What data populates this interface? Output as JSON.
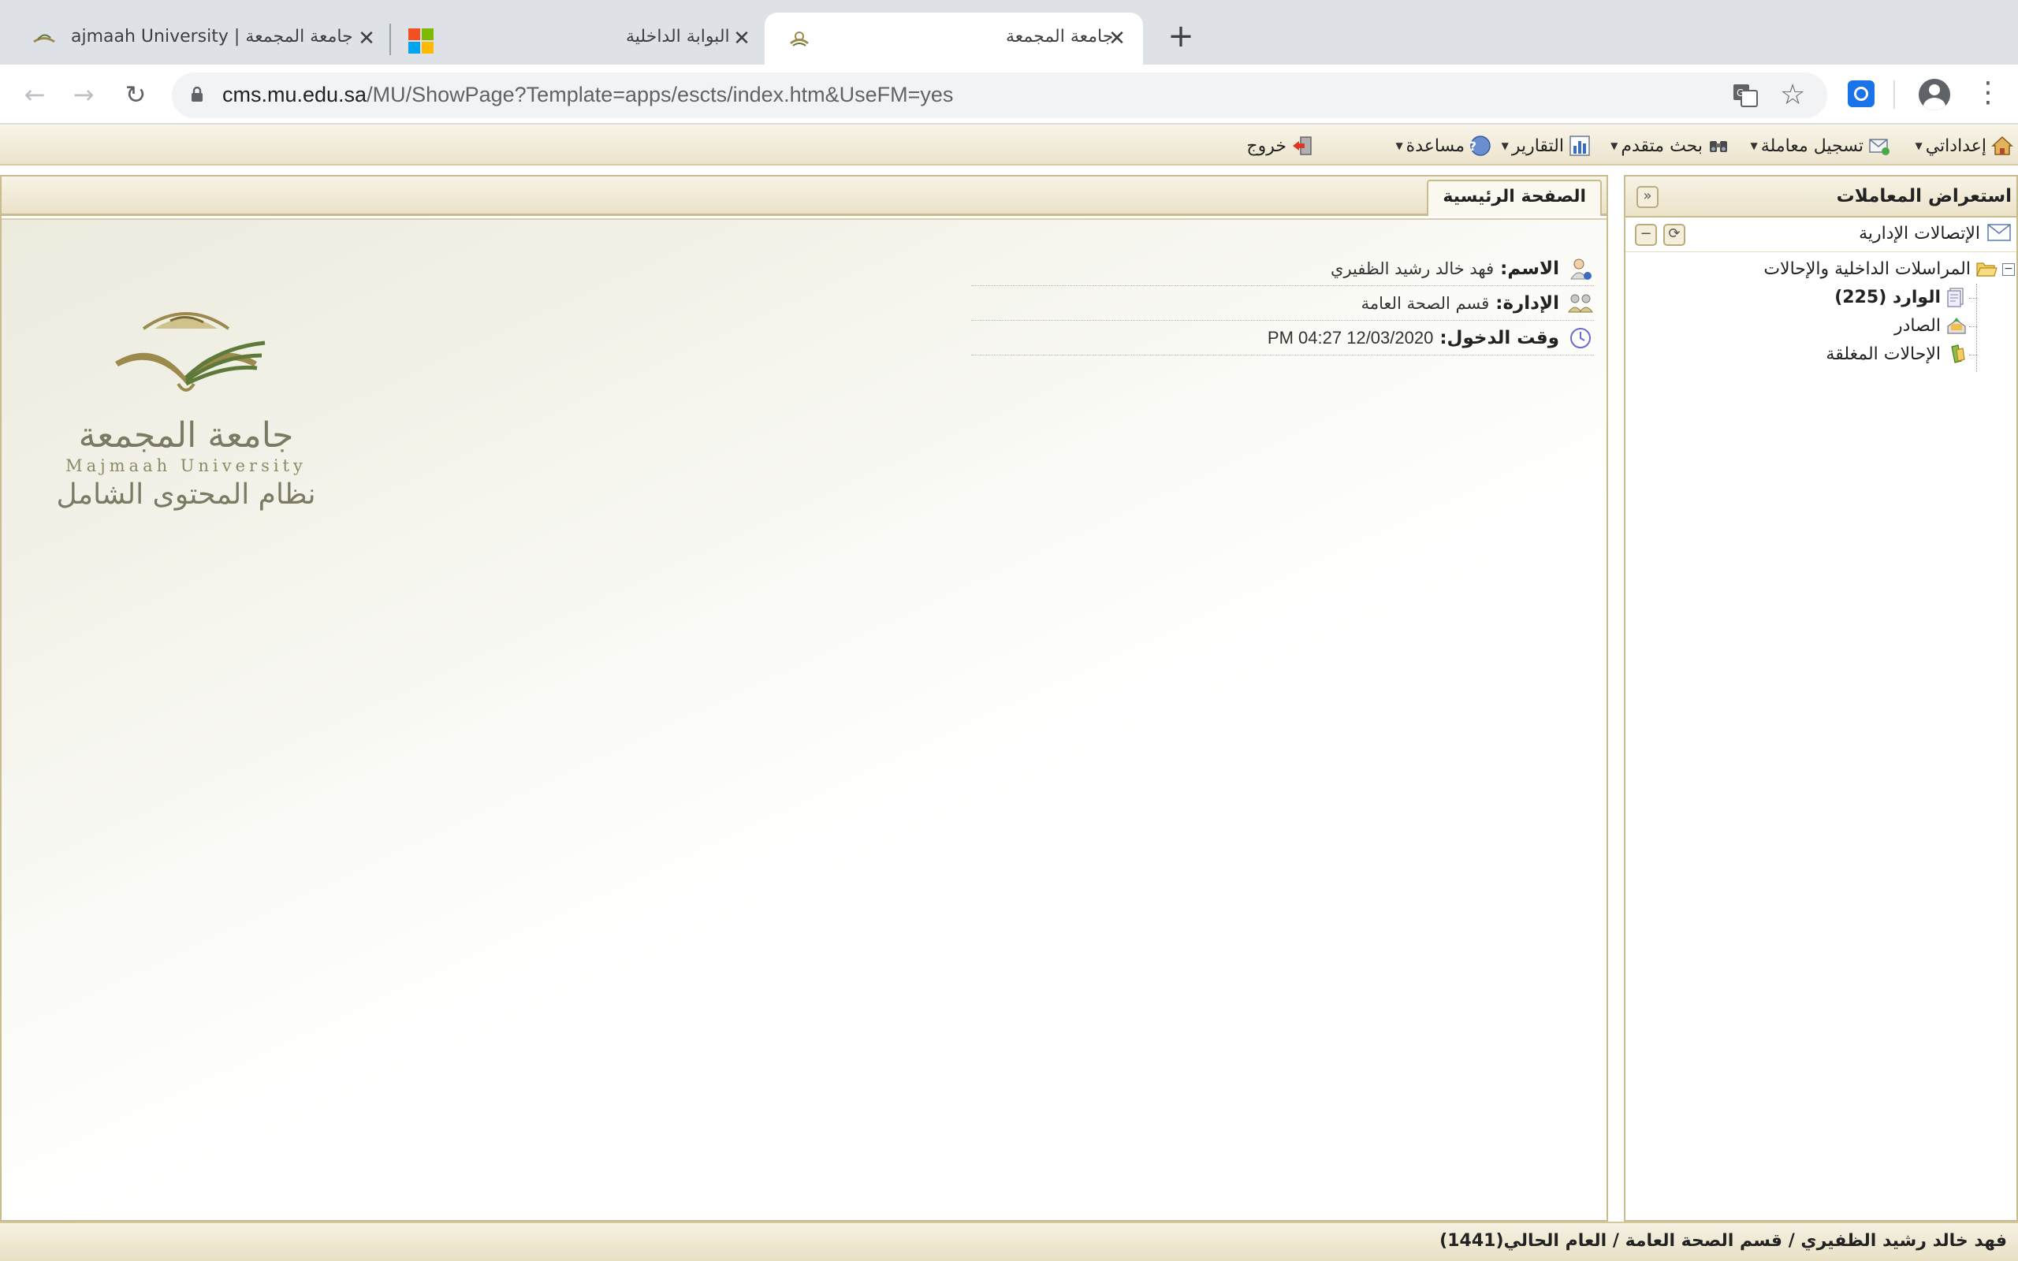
{
  "browser": {
    "tabs": [
      {
        "title": "ajmaah University | جامعة المجمعة",
        "active": false
      },
      {
        "title": "البوابة الداخلية",
        "active": false
      },
      {
        "title": "جامعة المجمعة",
        "active": true
      }
    ],
    "new_tab_symbol": "+",
    "close_symbol": "✕",
    "url_host": "cms.mu.edu.sa",
    "url_path": "/MU/ShowPage?Template=apps/escts/index.htm&UseFM=yes"
  },
  "appbar": {
    "items": [
      {
        "label": "إعداداتي",
        "icon": "home-icon"
      },
      {
        "label": "تسجيل معاملة",
        "icon": "envelope-add-icon"
      },
      {
        "label": "بحث متقدم",
        "icon": "binoculars-icon"
      },
      {
        "label": "التقارير",
        "icon": "bar-chart-icon"
      },
      {
        "label": "مساعدة",
        "icon": "help-icon"
      },
      {
        "label": "خروج",
        "icon": "exit-icon"
      }
    ]
  },
  "sidepanel": {
    "title": "استعراض المعاملات",
    "section": "الإتصالات الإدارية",
    "tree": {
      "root": "المراسلات الداخلية والإحالات",
      "items": [
        {
          "label": "الوارد (225)",
          "bold": true,
          "icon": "inbox-icon"
        },
        {
          "label": "الصادر",
          "bold": false,
          "icon": "outbox-icon"
        },
        {
          "label": "الإحالات المغلقة",
          "bold": false,
          "icon": "closed-referrals-icon"
        }
      ]
    }
  },
  "main": {
    "tab_label": "الصفحة الرئيسية",
    "user_info": {
      "name_label": "الاسم:",
      "name_value": "فهد خالد رشيد الظفيري",
      "dept_label": "الإدارة:",
      "dept_value": "قسم الصحة العامة",
      "login_label": "وقت الدخول:",
      "login_value": "12/03/2020 04:27 PM"
    },
    "logo": {
      "arabic_name": "جامعة المجمعة",
      "english_name": "Majmaah University",
      "system_name": "نظام المحتوى الشامل"
    }
  },
  "statusbar": {
    "text": "فهد خالد رشيد الظفيري / قسم الصحة العامة / العام الحالي(1441)"
  },
  "colors": {
    "accent_border": "#c9bc8e",
    "panel_header": "#ebe2c8",
    "logo_gold": "#9c8a4c",
    "logo_green": "#5e7a3a"
  }
}
